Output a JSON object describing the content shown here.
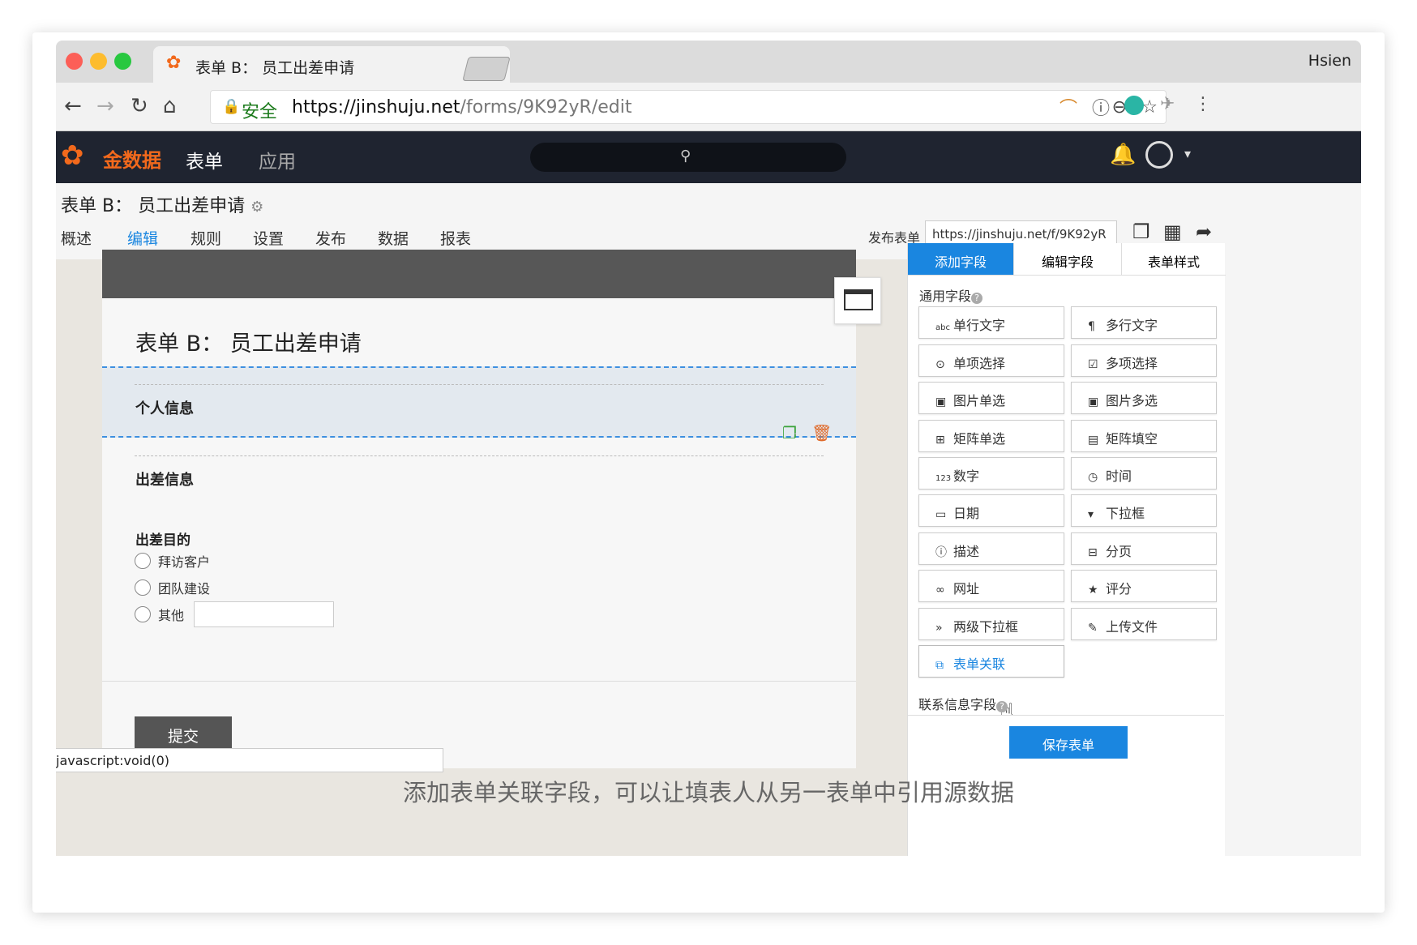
{
  "browser": {
    "tab_title": "表单 B： 员工出差申请",
    "tab_close": "×",
    "profile": "Hsien",
    "secure_label": "安全",
    "url_host": "https://jinshuju.net",
    "url_path": "/forms/9K92yR/edit",
    "icons": {
      "back": "←",
      "forward": "→",
      "reload": "↻",
      "home": "⌂",
      "lock": "🔒",
      "zoom": "⊖",
      "star": "☆",
      "menu": "⋮"
    }
  },
  "app": {
    "logo_text": "金数据",
    "nav": [
      "表单",
      "应用"
    ],
    "search_icon": "⚲"
  },
  "form": {
    "title": "表单 B： 员工出差申请",
    "subnav": [
      "概述",
      "编辑",
      "规则",
      "设置",
      "发布",
      "数据",
      "报表"
    ],
    "active_subnav": "编辑",
    "publish_label": "发布表单",
    "publish_url": "https://jinshuju.net/f/9K92yR"
  },
  "canvas": {
    "title": "表单 B： 员工出差申请",
    "section1": "个人信息",
    "section2": "出差信息",
    "question": "出差目的",
    "options": [
      "拜访客户",
      "团队建设",
      "其他"
    ],
    "submit": "提交",
    "status_text": "javascript:void(0)"
  },
  "panel": {
    "tabs": [
      "添加字段",
      "编辑字段",
      "表单样式"
    ],
    "group1": "通用字段",
    "group2": "联系信息字段",
    "fields": [
      {
        "icon": "abc",
        "label": "单行文字"
      },
      {
        "icon": "¶",
        "label": "多行文字"
      },
      {
        "icon": "⊙",
        "label": "单项选择"
      },
      {
        "icon": "☑",
        "label": "多项选择"
      },
      {
        "icon": "▣",
        "label": "图片单选"
      },
      {
        "icon": "▣",
        "label": "图片多选"
      },
      {
        "icon": "⊞",
        "label": "矩阵单选"
      },
      {
        "icon": "▤",
        "label": "矩阵填空"
      },
      {
        "icon": "123",
        "label": "数字"
      },
      {
        "icon": "◷",
        "label": "时间"
      },
      {
        "icon": "▭",
        "label": "日期"
      },
      {
        "icon": "▾",
        "label": "下拉框"
      },
      {
        "icon": "ⓘ",
        "label": "描述"
      },
      {
        "icon": "⊟",
        "label": "分页"
      },
      {
        "icon": "∞",
        "label": "网址"
      },
      {
        "icon": "★",
        "label": "评分"
      },
      {
        "icon": "»",
        "label": "两级下拉框"
      },
      {
        "icon": "✎",
        "label": "上传文件"
      },
      {
        "icon": "⧉",
        "label": "表单关联"
      }
    ],
    "save": "保存表单"
  },
  "caption": "添加表单关联字段，可以让填表人从另一表单中引用源数据"
}
